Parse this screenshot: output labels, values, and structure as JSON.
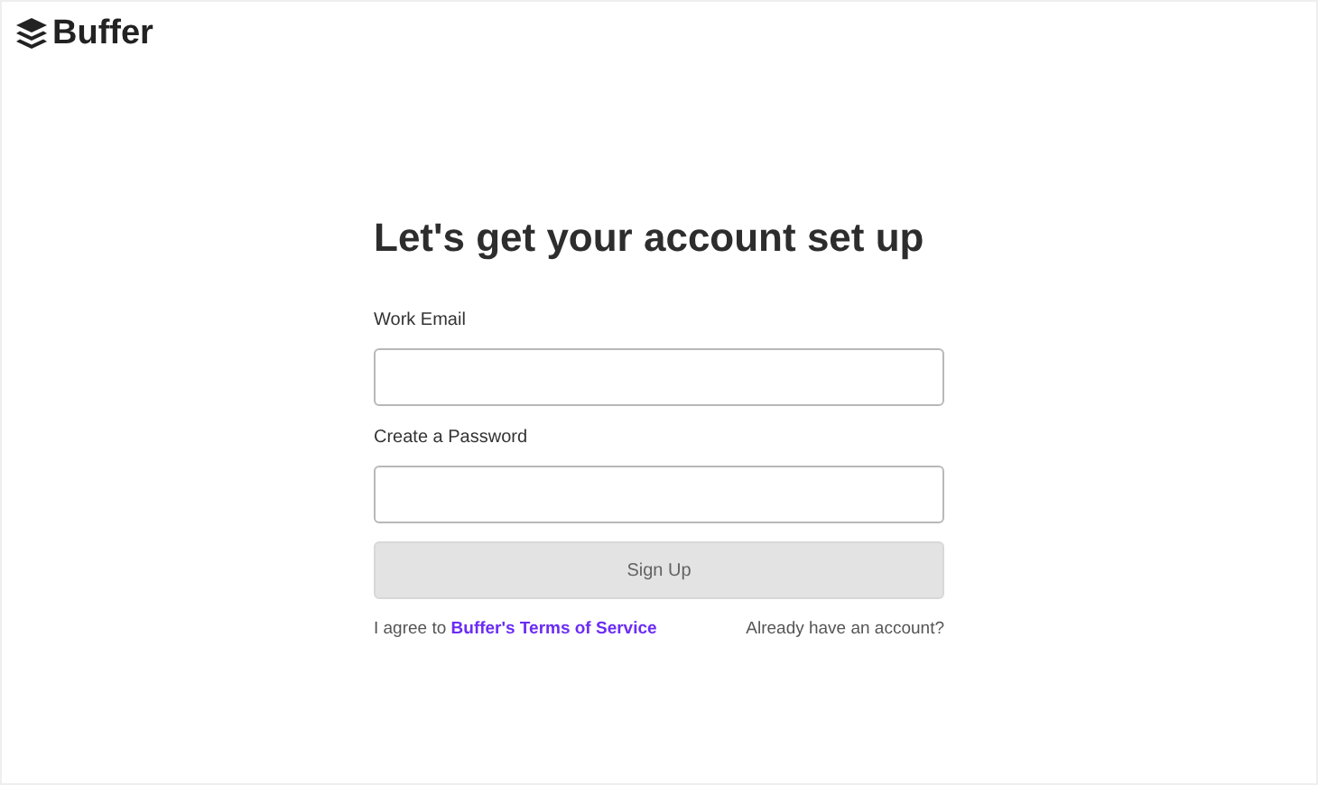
{
  "logo": {
    "text": "Buffer"
  },
  "heading": "Let's get your account set up",
  "fields": [
    {
      "label": "Work Email"
    },
    {
      "label": "Create a Password"
    }
  ],
  "submit": {
    "label": "Sign Up",
    "disabled": true
  },
  "terms": {
    "prefix": "I agree to",
    "link": "Buffer's Terms of Service"
  },
  "login_link": "Already have an account?"
}
